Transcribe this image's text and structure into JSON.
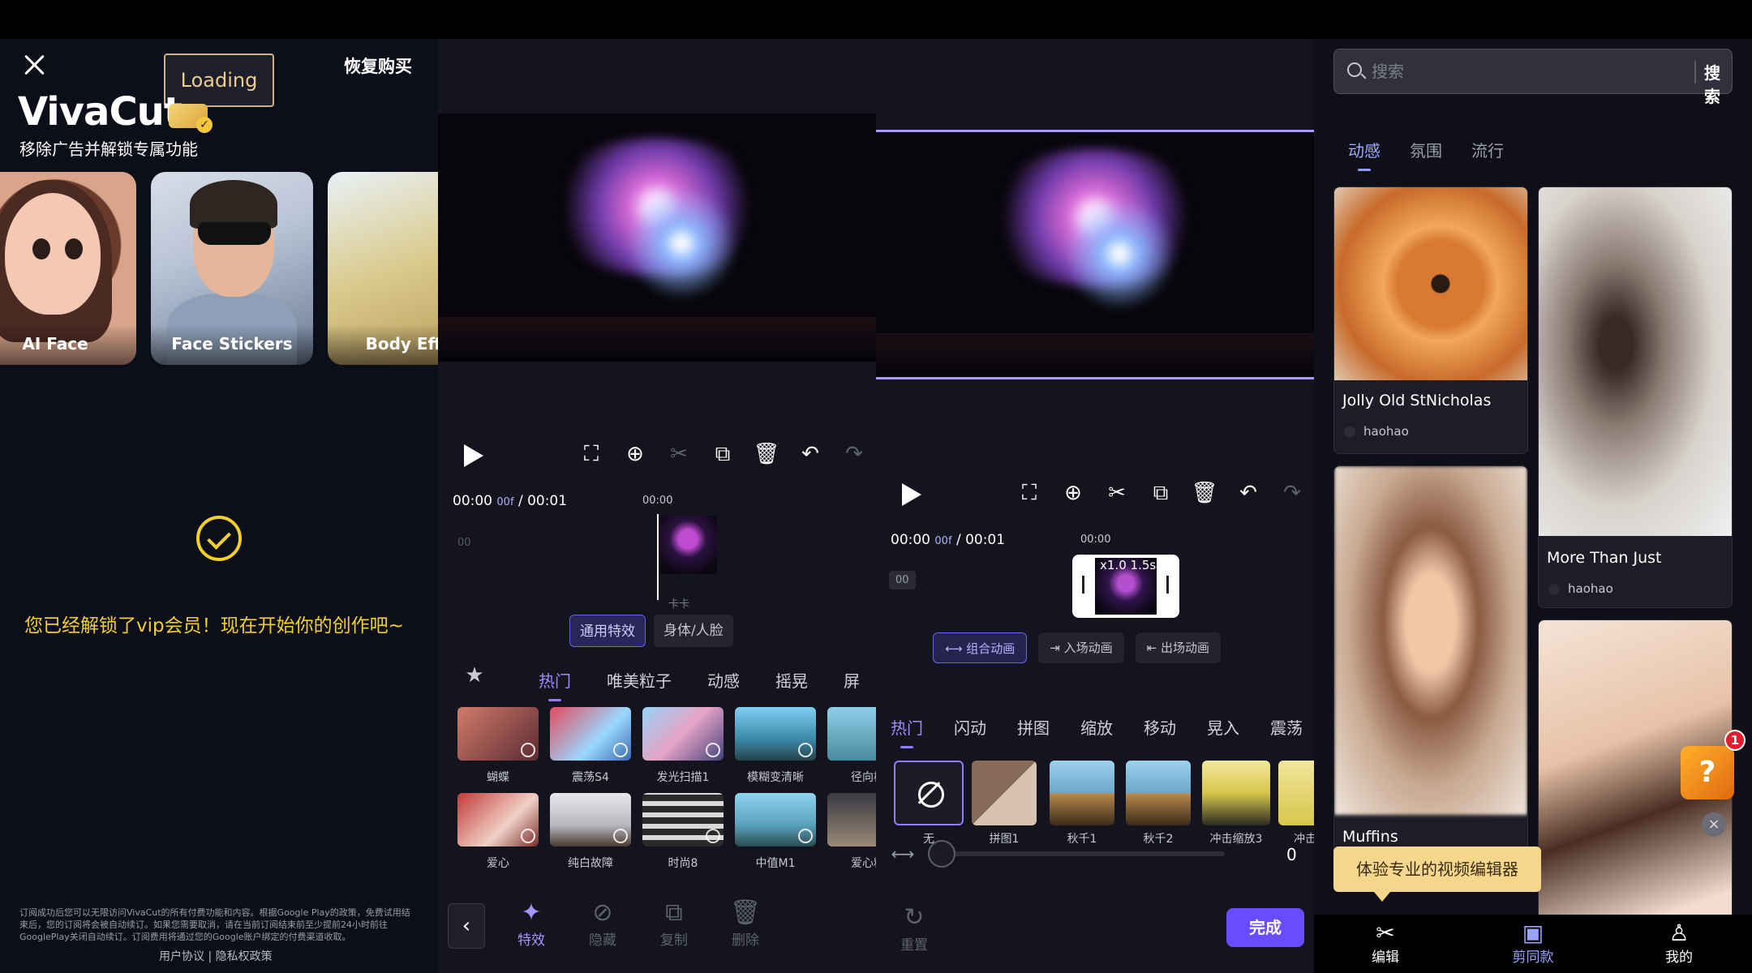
{
  "panel1": {
    "loading": "Loading",
    "restore": "恢复购买",
    "brand": "VivaCut",
    "subtitle": "移除广告并解锁专属功能",
    "features": [
      "AI Face",
      "Face Stickers",
      "Body Effe"
    ],
    "vip_message": "您已经解锁了vip会员！现在开始你的创作吧~",
    "legal": "订阅成功后您可以无限访问VivaCut的所有付费功能和内容。根据Google Play的政策，免费试用结束后，您的订阅将会被自动续订。如果您需要取消，请在当前订阅结束前至少提前24小时前往GooglePlay关闭自动续订。订阅费用将通过您的Google账户绑定的付费渠道收取。",
    "links": "用户协议 | 隐私权政策"
  },
  "panel2": {
    "timecode": "00:00",
    "frame": "00f",
    "duration": "/ 00:01",
    "tick": "00:00",
    "track_label": "00",
    "seg_tabs": [
      "通用特效",
      "身体/人脸"
    ],
    "categories": [
      "热门",
      "唯美粒子",
      "动感",
      "摇晃",
      "屏"
    ],
    "effects_row1": [
      "蝴蝶",
      "震荡S4",
      "发光扫描1",
      "模糊变清晰",
      "径向模"
    ],
    "effects_row2": [
      "爱心",
      "纯白故障",
      "时尚8",
      "中值M1",
      "爱心粒"
    ],
    "nav": [
      "特效",
      "隐藏",
      "复制",
      "删除"
    ],
    "clip_label": "卡卡"
  },
  "panel3": {
    "timecode": "00:00",
    "frame": "00f",
    "duration": "/ 00:01",
    "tick": "00:00",
    "track_label": "00",
    "speed": "x1.0",
    "clip_len": "1.5s",
    "anim_tabs": [
      "组合动画",
      "入场动画",
      "出场动画"
    ],
    "categories": [
      "热门",
      "闪动",
      "拼图",
      "缩放",
      "移动",
      "晃入",
      "震荡"
    ],
    "anims": [
      "无",
      "拼图1",
      "秋千1",
      "秋千2",
      "冲击缩放3",
      "冲击缩"
    ],
    "slider_value": "0",
    "reset": "重置",
    "done": "完成"
  },
  "panel4": {
    "search_placeholder": "搜索",
    "search_btn": "搜索",
    "tabs": [
      "动感",
      "氛围",
      "流行"
    ],
    "templates": [
      {
        "title": "Jolly Old StNicholas",
        "author": "haohao"
      },
      {
        "title": "More Than Just",
        "author": "haohao"
      },
      {
        "title": "Muffins",
        "author": ""
      }
    ],
    "tip": "体验专业的视频编辑器",
    "gift_badge": "1",
    "gift_mark": "?",
    "tabbar": [
      "编辑",
      "剪同款",
      "我的"
    ]
  }
}
